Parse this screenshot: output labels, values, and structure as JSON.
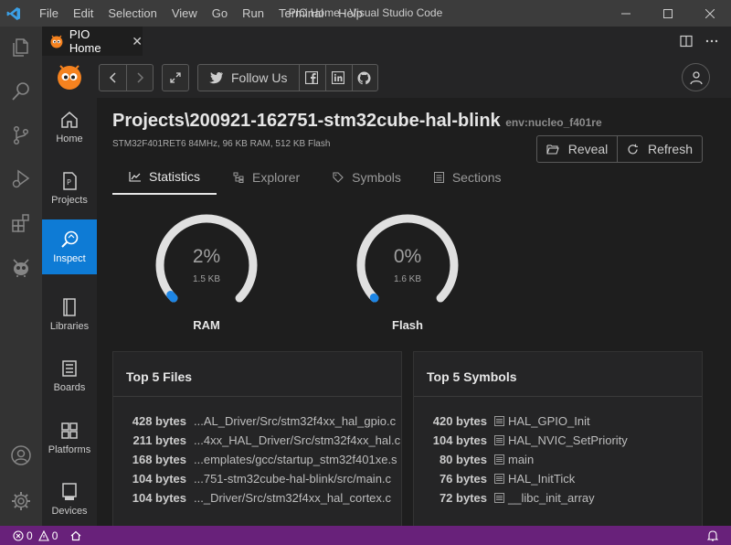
{
  "window": {
    "title": "PIO Home - Visual Studio Code",
    "menu": [
      "File",
      "Edit",
      "Selection",
      "View",
      "Go",
      "Run",
      "Terminal",
      "Help"
    ]
  },
  "activity_bar": {
    "items": [
      "explorer-icon",
      "search-icon",
      "source-control-icon",
      "run-debug-icon",
      "extensions-icon",
      "platformio-icon",
      "account-icon",
      "settings-gear-icon"
    ]
  },
  "editor_tab": {
    "label": "PIO Home",
    "close": "✕"
  },
  "pio_nav": {
    "items": [
      {
        "label": "Home",
        "icon": "home-icon"
      },
      {
        "label": "Projects",
        "icon": "projects-icon"
      },
      {
        "label": "Inspect",
        "icon": "inspect-icon",
        "active": true
      },
      {
        "label": "Libraries",
        "icon": "libraries-icon"
      },
      {
        "label": "Boards",
        "icon": "boards-icon"
      },
      {
        "label": "Platforms",
        "icon": "platforms-icon"
      },
      {
        "label": "Devices",
        "icon": "devices-icon"
      }
    ]
  },
  "toolbar": {
    "follow_label": "Follow Us"
  },
  "project": {
    "title": "Projects\\200921-162751-stm32cube-hal-blink",
    "env": "env:nucleo_f401re",
    "subtitle": "STM32F401RET6 84MHz, 96 KB RAM, 512 KB Flash",
    "reveal_label": "Reveal",
    "refresh_label": "Refresh"
  },
  "inspect_tabs": [
    {
      "label": "Statistics",
      "active": true
    },
    {
      "label": "Explorer"
    },
    {
      "label": "Symbols"
    },
    {
      "label": "Sections"
    }
  ],
  "gauges": [
    {
      "label": "RAM",
      "percent": "2%",
      "size": "1.5 KB",
      "fraction": 0.02
    },
    {
      "label": "Flash",
      "percent": "0%",
      "size": "1.6 KB",
      "fraction": 0.003
    }
  ],
  "top_files": {
    "title": "Top 5 Files",
    "rows": [
      {
        "size": "428 bytes",
        "name": "...AL_Driver/Src/stm32f4xx_hal_gpio.c"
      },
      {
        "size": "211 bytes",
        "name": "...4xx_HAL_Driver/Src/stm32f4xx_hal.c"
      },
      {
        "size": "168 bytes",
        "name": "...emplates/gcc/startup_stm32f401xe.s"
      },
      {
        "size": "104 bytes",
        "name": "...751-stm32cube-hal-blink/src/main.c"
      },
      {
        "size": "104 bytes",
        "name": "..._Driver/Src/stm32f4xx_hal_cortex.c"
      }
    ]
  },
  "top_symbols": {
    "title": "Top 5 Symbols",
    "rows": [
      {
        "size": "420 bytes",
        "name": "HAL_GPIO_Init"
      },
      {
        "size": "104 bytes",
        "name": "HAL_NVIC_SetPriority"
      },
      {
        "size": "80 bytes",
        "name": "main"
      },
      {
        "size": "76 bytes",
        "name": "HAL_InitTick"
      },
      {
        "size": "72 bytes",
        "name": "__libc_init_array"
      }
    ]
  },
  "status_bar": {
    "errors": "0",
    "warnings": "0"
  },
  "colors": {
    "accent": "#0e7bd5",
    "status": "#68217a"
  }
}
